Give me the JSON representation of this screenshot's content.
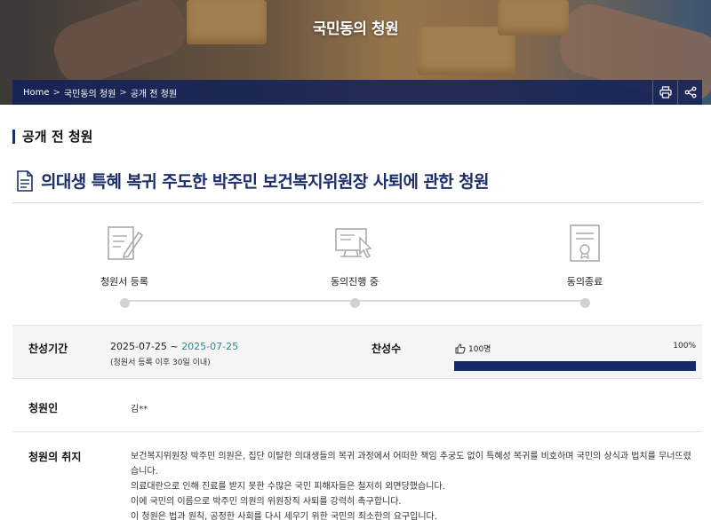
{
  "hero": {
    "title": "국민동의 청원"
  },
  "breadcrumb": {
    "items": [
      "Home",
      "국민동의 청원",
      "공개 전 청원"
    ],
    "separator": ">"
  },
  "actions": {
    "print_icon": "print-icon",
    "share_icon": "share-icon"
  },
  "section": {
    "title": "공개 전 청원"
  },
  "petition": {
    "title": "의대생 특혜 복귀 주도한 박주민 보건복지위원장 사퇴에 관한 청원",
    "steps": [
      {
        "label": "청원서 등록",
        "icon": "document-edit-icon"
      },
      {
        "label": "동의진행 중",
        "icon": "computer-click-icon"
      },
      {
        "label": "동의종료",
        "icon": "certificate-icon"
      }
    ],
    "period_label": "찬성기간",
    "period_start": "2025-07-25",
    "period_sep": " ~ ",
    "period_end": "2025-07-25",
    "period_note": "(청원서 등록 이후 30일 이내)",
    "votes_label": "찬성수",
    "votes": "100명",
    "progress_text": "100%",
    "progress": 1.0,
    "petitioner_label": "청원인",
    "petitioner": "김**",
    "purpose_label": "청원의 취지",
    "purpose_lines": [
      "보건복지위원장 박주민 의원은, 집단 이탈한 의대생들의 복귀 과정에서 어떠한 책임 추궁도 없이 특혜성 복귀를 비호하며 국민의 상식과 법치를 무너뜨렸습니다.",
      "의료대란으로 인해 진료를 받지 못한 수많은 국민 피해자들은 철저히 외면당했습니다.",
      "이에 국민의 이름으로 박주민 의원의 위원장직 사퇴를 강력히 촉구합니다.",
      "이 청원은 법과 원칙, 공정한 사회를 다시 세우기 위한 국민의 최소한의 요구입니다."
    ]
  },
  "colors": {
    "navy": "#1b2d6b",
    "bar": "#142a6e",
    "end_date": "#2f8a8f",
    "track": "#d9d9d9"
  }
}
